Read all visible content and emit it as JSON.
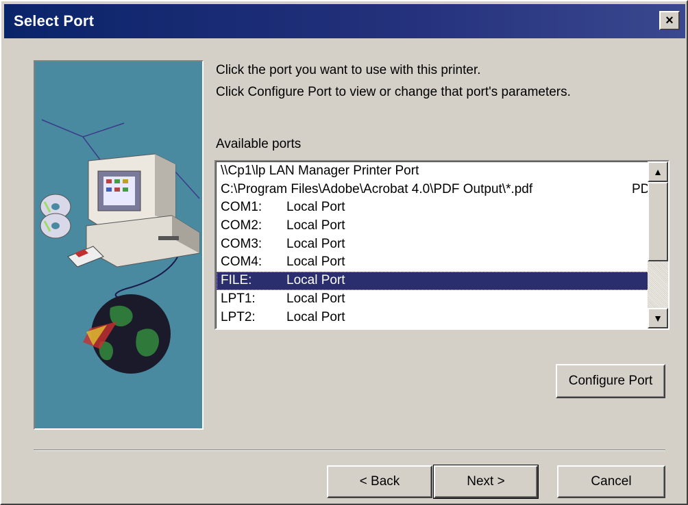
{
  "window": {
    "title": "Select Port",
    "close_label": "×"
  },
  "instructions": {
    "line1": "Click the port you want to use with this printer.",
    "line2": "Click Configure Port to view or change that port's parameters."
  },
  "ports": {
    "label": "Available ports",
    "items": [
      {
        "full": "\\\\Cp1\\lp LAN Manager Printer Port",
        "selected": false
      },
      {
        "full": "C:\\Program Files\\Adobe\\Acrobat 4.0\\PDF Output\\*.pdf",
        "trunc": "PD",
        "selected": false
      },
      {
        "port": "COM1:",
        "desc": "Local Port",
        "selected": false
      },
      {
        "port": "COM2:",
        "desc": "Local Port",
        "selected": false
      },
      {
        "port": "COM3:",
        "desc": "Local Port",
        "selected": false
      },
      {
        "port": "COM4:",
        "desc": "Local Port",
        "selected": false
      },
      {
        "port": "FILE:",
        "desc": "Local Port",
        "selected": true
      },
      {
        "port": "LPT1:",
        "desc": "Local Port",
        "selected": false
      },
      {
        "port": "LPT2:",
        "desc": "Local Port",
        "selected": false
      }
    ],
    "scroll_up_icon": "scroll-up-arrow",
    "scroll_down_icon": "scroll-down-arrow"
  },
  "buttons": {
    "configure": {
      "label": "Configure Port",
      "mnemonic": "o"
    },
    "back": {
      "label": "< Back",
      "mnemonic": "B"
    },
    "next": {
      "label": "Next >",
      "mnemonic": "N"
    },
    "cancel": {
      "label": "Cancel",
      "mnemonic": "C"
    }
  },
  "colors": {
    "titlebar": "#0a246a",
    "dialog_bg": "#d4d0c8",
    "selection_bg": "#2a2d6e",
    "wizard_bg": "#4a8aa0"
  }
}
